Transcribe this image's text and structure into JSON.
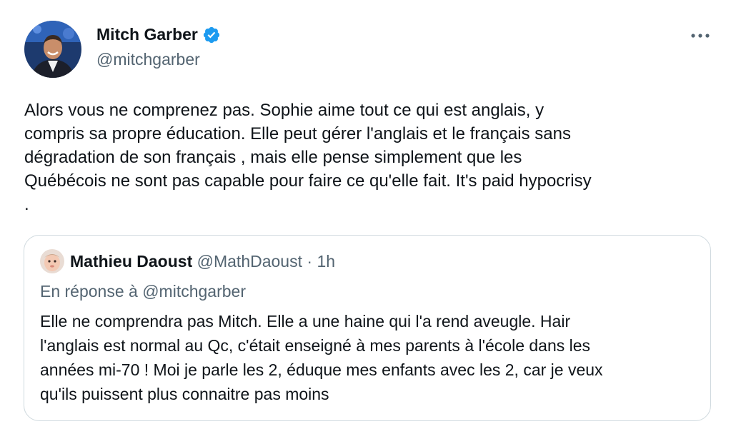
{
  "author": {
    "name": "Mitch Garber",
    "handle": "@mitchgarber",
    "verified": true,
    "avatar_icon": "person-avatar"
  },
  "tweet": {
    "text": "Alors vous ne comprenez pas. Sophie aime tout ce qui est anglais, y\ncompris sa propre éducation. Elle peut gérer l'anglais et le français sans\ndégradation de son français , mais elle pense simplement que les\nQuébécois ne sont pas capable pour faire ce qu'elle fait. It's paid hypocrisy\n."
  },
  "quoted": {
    "name": "Mathieu Daoust",
    "handle": "@MathDaoust",
    "separator": "·",
    "time": "1h",
    "reply_context": "En réponse à @mitchgarber",
    "text": "Elle ne comprendra pas Mitch. Elle a une haine qui l'a rend aveugle. Hair\nl'anglais est normal au Qc, c'était enseigné à mes parents à l'école dans les\nannées mi-70 ! Moi je parle les 2, éduque mes enfants avec les 2, car je veux\nqu'ils puissent plus connaitre pas moins"
  },
  "colors": {
    "text": "#0f1419",
    "secondary": "#536471",
    "verified": "#1d9bf0",
    "border": "#cfd9de"
  },
  "icons": {
    "verified": "verified-badge-icon",
    "more": "more-options-icon"
  }
}
